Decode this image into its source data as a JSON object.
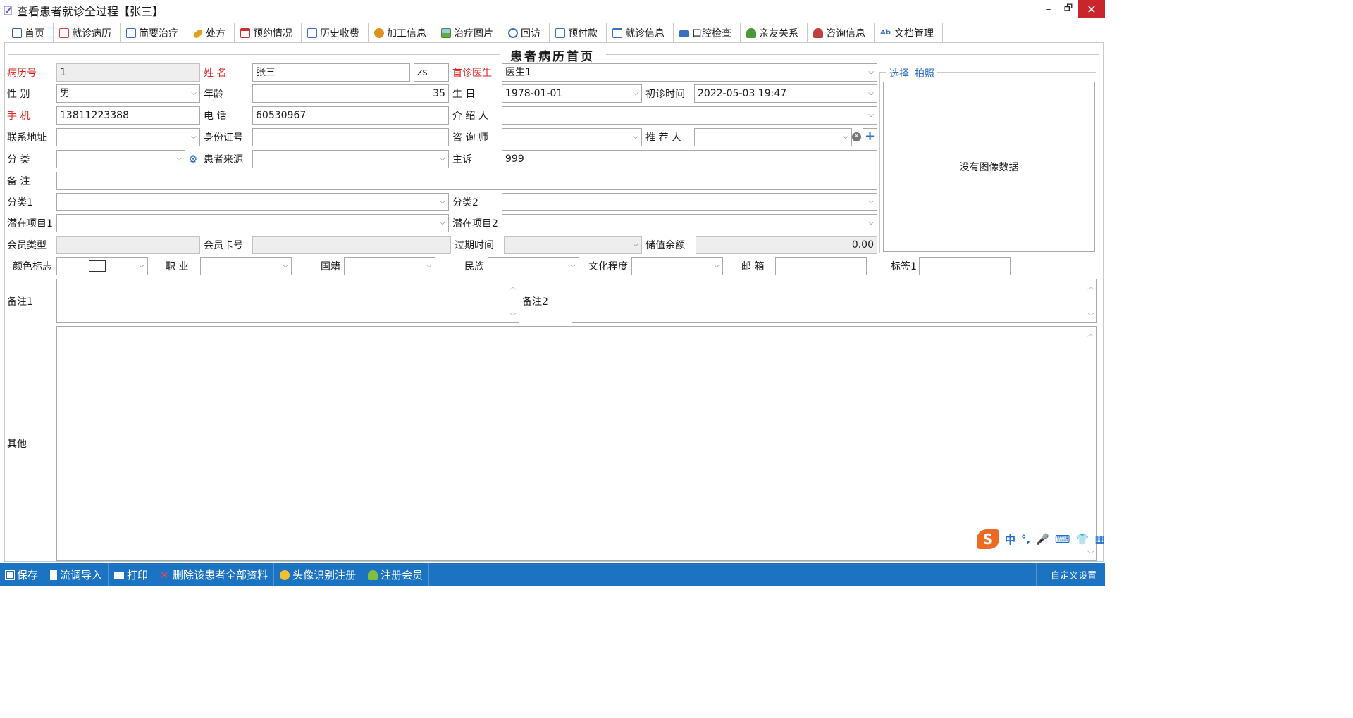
{
  "window": {
    "title": "查看患者就诊全过程【张三】",
    "controls": {
      "minimize": "–",
      "restore": "🗗",
      "close": "✕"
    }
  },
  "tabs": [
    {
      "label": "首页",
      "icon": "home-doc-icon",
      "color": "#3a5a9a"
    },
    {
      "label": "就诊病历",
      "icon": "record-icon",
      "color": "#d04040"
    },
    {
      "label": "简要治疗",
      "icon": "notes-icon",
      "color": "#3a6fbf"
    },
    {
      "label": "处方",
      "icon": "pill-icon",
      "color": "#e0a020"
    },
    {
      "label": "预约情况",
      "icon": "calendar-icon",
      "color": "#c83030"
    },
    {
      "label": "历史收费",
      "icon": "bill-icon",
      "color": "#3a6fbf"
    },
    {
      "label": "加工信息",
      "icon": "process-icon",
      "color": "#e09020"
    },
    {
      "label": "治疗图片",
      "icon": "image-icon",
      "color": "#4a8a3a"
    },
    {
      "label": "回访",
      "icon": "refresh-icon",
      "color": "#3a6fbf"
    },
    {
      "label": "预付款",
      "icon": "prepay-icon",
      "color": "#3a6fbf"
    },
    {
      "label": "就诊信息",
      "icon": "clipboard-icon",
      "color": "#3a6fbf"
    },
    {
      "label": "口腔检查",
      "icon": "toolbox-icon",
      "color": "#3a6fbf"
    },
    {
      "label": "亲友关系",
      "icon": "people-icon",
      "color": "#4a9a3a"
    },
    {
      "label": "咨询信息",
      "icon": "consult-icon",
      "color": "#c04040"
    },
    {
      "label": "文档管理",
      "icon": "spellcheck-icon",
      "color": "#3a6fbf"
    }
  ],
  "form": {
    "title": "患者病历首页",
    "record_no": {
      "label": "病历号",
      "value": "1"
    },
    "name": {
      "label": "姓  名",
      "value": "张三",
      "pinyin": "zs"
    },
    "first_doctor": {
      "label": "首诊医生",
      "value": "医生1"
    },
    "gender": {
      "label": "性  别",
      "value": "男"
    },
    "age": {
      "label": "年龄",
      "value": "35"
    },
    "birthday": {
      "label": "生  日",
      "value": "1978-01-01"
    },
    "first_visit_time": {
      "label": "初诊时间",
      "value": "2022-05-03 19:47"
    },
    "mobile": {
      "label": "手  机",
      "value": "13811223388"
    },
    "phone": {
      "label": "电  话",
      "value": "60530967"
    },
    "introducer": {
      "label": "介 绍 人",
      "value": ""
    },
    "address": {
      "label": "联系地址",
      "value": ""
    },
    "id_card": {
      "label": "身份证号",
      "value": ""
    },
    "consultant": {
      "label": "咨 询 师",
      "value": ""
    },
    "referrer": {
      "label": "推 荐 人",
      "value": ""
    },
    "category": {
      "label": "分  类",
      "value": ""
    },
    "source": {
      "label": "患者来源",
      "value": ""
    },
    "complaint": {
      "label": "主诉",
      "value": "999"
    },
    "remark": {
      "label": "备  注",
      "value": ""
    },
    "category1": {
      "label": "分类1",
      "value": ""
    },
    "category2": {
      "label": "分类2",
      "value": ""
    },
    "potential1": {
      "label": "潜在项目1",
      "value": ""
    },
    "potential2": {
      "label": "潜在项目2",
      "value": ""
    },
    "member_type": {
      "label": "会员类型",
      "value": ""
    },
    "member_card": {
      "label": "会员卡号",
      "value": ""
    },
    "expire_time": {
      "label": "过期时间",
      "value": ""
    },
    "balance": {
      "label": "储值余额",
      "value": "0.00"
    },
    "color_flag": {
      "label": "颜色标志"
    },
    "occupation": {
      "label": "职  业",
      "value": ""
    },
    "nationality": {
      "label": "国籍",
      "value": ""
    },
    "ethnicity": {
      "label": "民族",
      "value": ""
    },
    "education": {
      "label": "文化程度",
      "value": ""
    },
    "email": {
      "label": "邮  箱",
      "value": ""
    },
    "tag1": {
      "label": "标签1",
      "value": ""
    },
    "remark1": {
      "label": "备注1",
      "value": ""
    },
    "remark2": {
      "label": "备注2",
      "value": ""
    },
    "other": {
      "label": "其他",
      "value": ""
    }
  },
  "photo": {
    "select_label": "选择",
    "shoot_label": "拍照",
    "empty_text": "没有图像数据"
  },
  "ime": {
    "logo": "S",
    "items": [
      "中",
      "°,",
      "🎤",
      "⌨",
      "👕",
      "▦"
    ]
  },
  "statusbar": {
    "buttons": [
      {
        "label": "保存",
        "icon": "save-icon"
      },
      {
        "label": "流调导入",
        "icon": "import-icon"
      },
      {
        "label": "打印",
        "icon": "print-icon"
      },
      {
        "label": "删除该患者全部资料",
        "icon": "delete-icon"
      },
      {
        "label": "头像识别注册",
        "icon": "face-icon"
      },
      {
        "label": "注册会员",
        "icon": "member-icon"
      }
    ],
    "custom_settings": "自定义设置"
  },
  "colors": {
    "statusbar": "#1b73c2",
    "required_label": "#e0201c",
    "close_button": "#c8262c",
    "link": "#2f6fc9"
  }
}
